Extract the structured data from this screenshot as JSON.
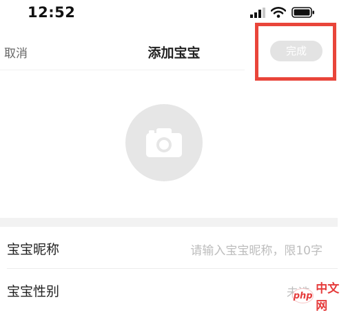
{
  "status_bar": {
    "time": "12:52",
    "icons": [
      "signal-icon",
      "wifi-icon",
      "battery-icon"
    ]
  },
  "nav": {
    "cancel_label": "取消",
    "title": "添加宝宝",
    "done_label": "完成"
  },
  "avatar": {
    "icon": "camera-icon"
  },
  "form": {
    "rows": [
      {
        "label": "宝宝昵称",
        "placeholder": "请输入宝宝昵称，限10字"
      },
      {
        "label": "宝宝性别",
        "value": "未选"
      }
    ]
  },
  "watermark": {
    "brand": "php",
    "text": "中文网"
  },
  "colors": {
    "highlight": "#e9453a",
    "done_button_bg": "#e3e3e3",
    "placeholder": "#bdbdbd",
    "avatar_bg": "#e6e6e6"
  }
}
